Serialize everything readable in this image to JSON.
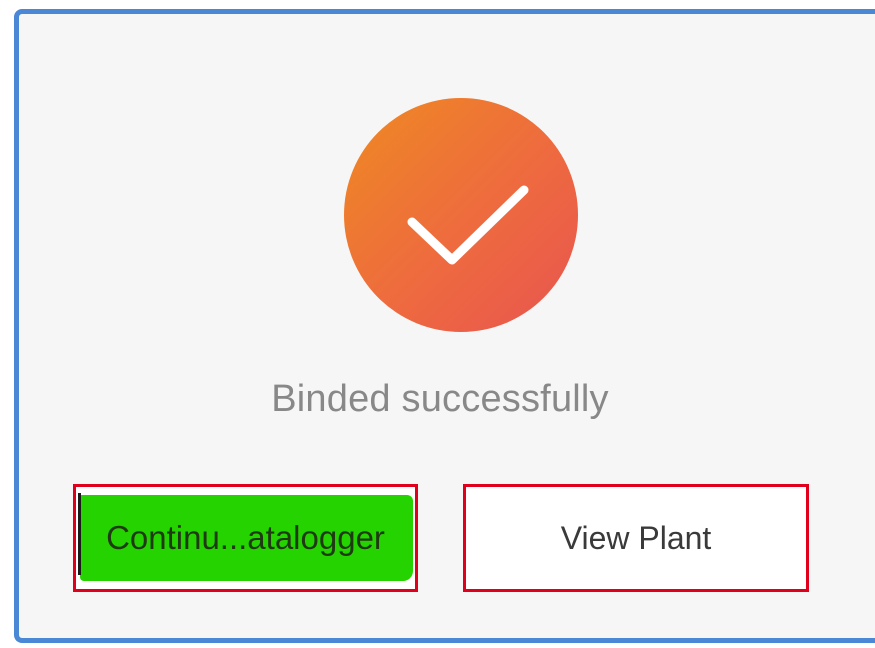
{
  "dialog": {
    "status": "Binded successfully",
    "accent_colors": {
      "border": "#4a88d6",
      "success_gradient": [
        "#ef8a22",
        "#e85550"
      ],
      "highlight": "#24d300",
      "outline": "#e0001b"
    },
    "icon": "checkmark-icon"
  },
  "actions": {
    "continue_label": "Continu...atalogger",
    "view_plant_label": "View Plant"
  }
}
